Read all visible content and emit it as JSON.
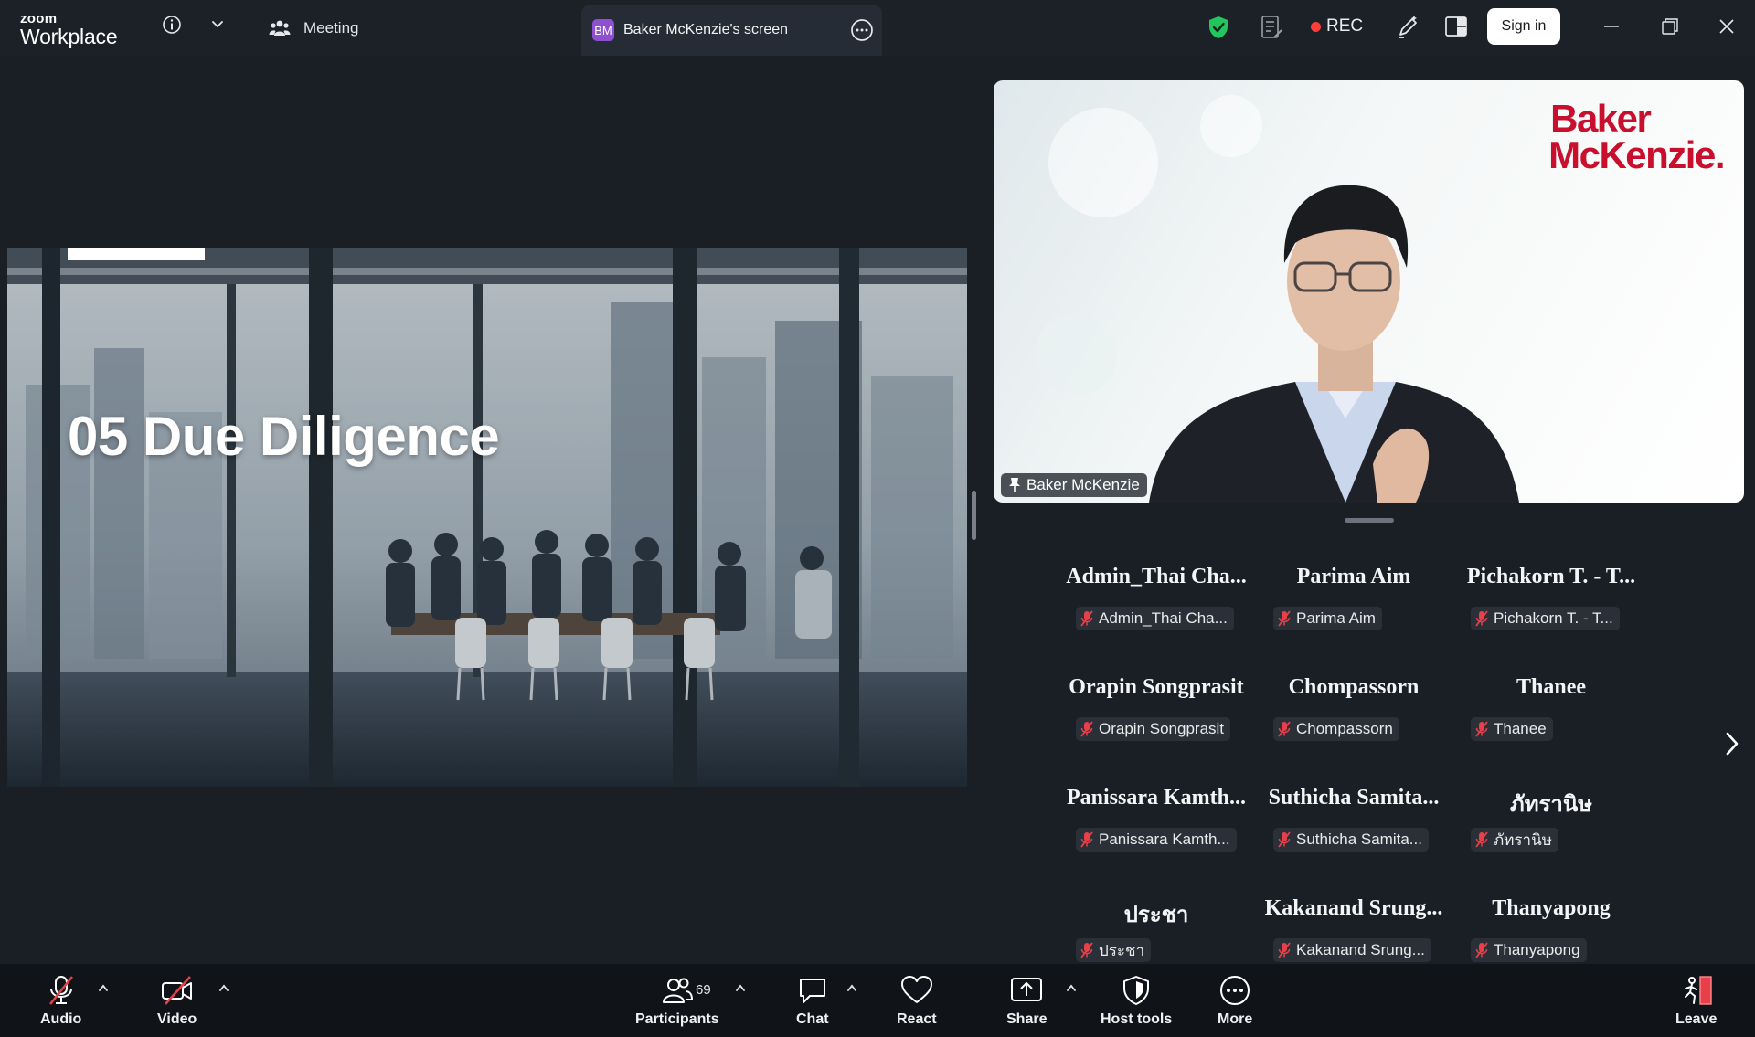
{
  "titlebar": {
    "brand_top": "zoom",
    "brand_bottom": "Workplace",
    "meeting_label": "Meeting",
    "screen_badge": "BM",
    "screen_label": "Baker McKenzie's screen",
    "rec_label": "REC",
    "signin_label": "Sign in"
  },
  "slide": {
    "title": "05  Due Diligence"
  },
  "speaker": {
    "name": "Baker McKenzie",
    "logo_line1": "Baker",
    "logo_line2": "McKenzie."
  },
  "participants": [
    {
      "big": "Admin_Thai  Cha...",
      "small": "Admin_Thai Cha..."
    },
    {
      "big": "Parima Aim",
      "small": "Parima Aim"
    },
    {
      "big": "Pichakorn T. - T...",
      "small": "Pichakorn T. - T..."
    },
    {
      "big": "Orapin Songprasit",
      "small": "Orapin Songprasit"
    },
    {
      "big": "Chompassorn",
      "small": "Chompassorn"
    },
    {
      "big": "Thanee",
      "small": "Thanee"
    },
    {
      "big": "Panissara  Kamth...",
      "small": "Panissara Kamth..."
    },
    {
      "big": "Suthicha  Samita...",
      "small": "Suthicha Samita..."
    },
    {
      "big": "ภัทรานิษ",
      "small": "ภัทรานิษ"
    },
    {
      "big": "ประชา",
      "small": "ประชา"
    },
    {
      "big": "Kakanand  Srung...",
      "small": "Kakanand Srung..."
    },
    {
      "big": "Thanyapong",
      "small": "Thanyapong"
    }
  ],
  "toolbar": {
    "audio": "Audio",
    "video": "Video",
    "participants": "Participants",
    "participant_count": "69",
    "chat": "Chat",
    "react": "React",
    "share": "Share",
    "host_tools": "Host tools",
    "more": "More",
    "leave": "Leave"
  },
  "colors": {
    "titlebar_bg": "#1c2128",
    "toolbar_bg": "#101318",
    "rec_dot": "#ff3b3b",
    "mute_red": "#e8404a",
    "shield_green": "#22c55e",
    "bm_red": "#c8102e",
    "bm_badge": "#8e4fd0"
  }
}
